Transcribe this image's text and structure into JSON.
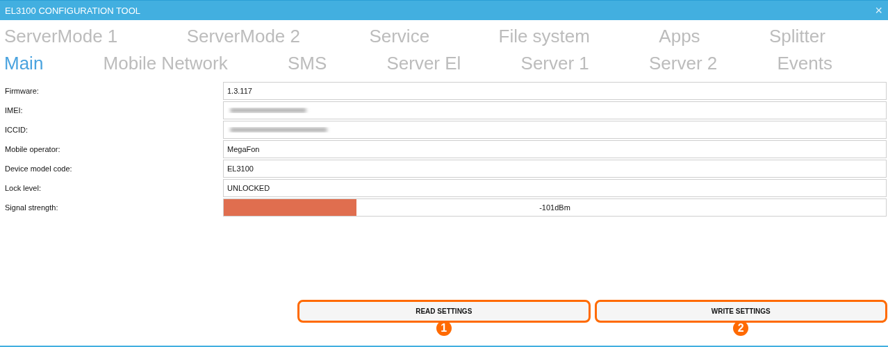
{
  "window": {
    "title": "EL3100 CONFIGURATION TOOL",
    "close": "×"
  },
  "tab_rows": [
    [
      {
        "label": "ServerMode 1",
        "selected": false
      },
      {
        "label": "ServerMode 2",
        "selected": false
      },
      {
        "label": "Service",
        "selected": false
      },
      {
        "label": "File system",
        "selected": false
      },
      {
        "label": "Apps",
        "selected": false
      },
      {
        "label": "Splitter",
        "selected": false
      }
    ],
    [
      {
        "label": "Main",
        "selected": true
      },
      {
        "label": "Mobile Network",
        "selected": false
      },
      {
        "label": "SMS",
        "selected": false
      },
      {
        "label": "Server El",
        "selected": false
      },
      {
        "label": "Server 1",
        "selected": false
      },
      {
        "label": "Server 2",
        "selected": false
      },
      {
        "label": "Events",
        "selected": false
      }
    ]
  ],
  "fields": [
    {
      "kind": "text",
      "label": "Firmware:",
      "value": "1.3.117"
    },
    {
      "kind": "redacted",
      "label": "IMEI:"
    },
    {
      "kind": "redacted",
      "label": "ICCID:"
    },
    {
      "kind": "text",
      "label": "Mobile operator:",
      "value": "MegaFon"
    },
    {
      "kind": "text",
      "label": "Device model code:",
      "value": "EL3100"
    },
    {
      "kind": "text",
      "label": "Lock level:",
      "value": "UNLOCKED"
    },
    {
      "kind": "meter",
      "label": "Signal strength:",
      "level": 0.2,
      "reading": "-101dBm"
    }
  ],
  "buttons": [
    {
      "label": "READ SETTINGS",
      "badge": "1"
    },
    {
      "label": "WRITE SETTINGS",
      "badge": "2"
    }
  ]
}
